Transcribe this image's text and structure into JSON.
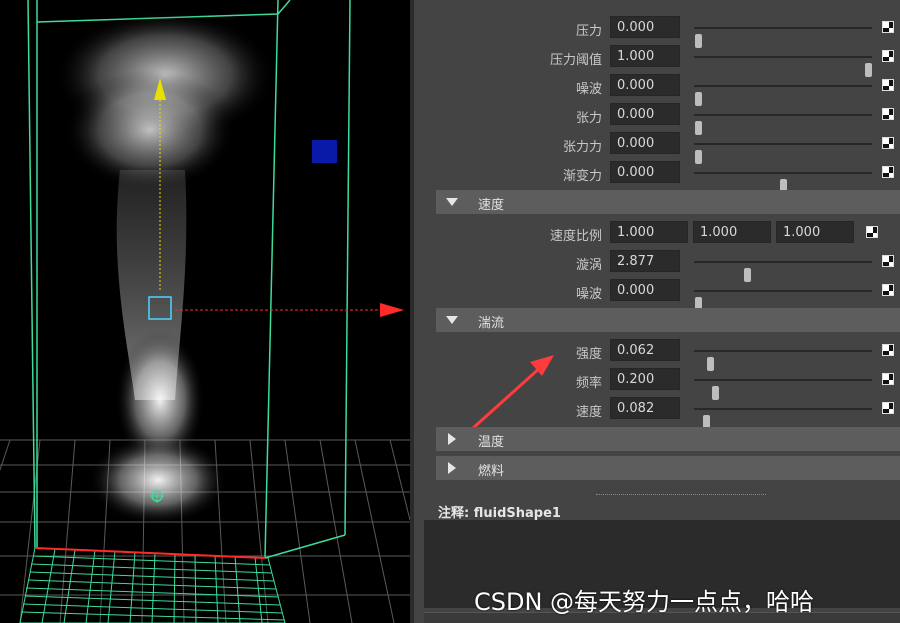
{
  "panel": {
    "top_rows": [
      {
        "label": "压力",
        "value": "0.000",
        "slider_fraction": 0.0
      },
      {
        "label": "压力阈值",
        "value": "1.000",
        "slider_fraction": 1.0
      },
      {
        "label": "噪波",
        "value": "0.000",
        "slider_fraction": 0.0
      },
      {
        "label": "张力",
        "value": "0.000",
        "slider_fraction": 0.0
      },
      {
        "label": "张力力",
        "value": "0.000",
        "slider_fraction": 0.0
      },
      {
        "label": "渐变力",
        "value": "0.000",
        "slider_fraction": 0.5
      }
    ],
    "velocity": {
      "title": "速度",
      "scale_label": "速度比例",
      "scale_values": [
        "1.000",
        "1.000",
        "1.000"
      ],
      "rows": [
        {
          "label": "漩涡",
          "value": "2.877",
          "slider_fraction": 0.3
        },
        {
          "label": "噪波",
          "value": "0.000",
          "slider_fraction": 0.0
        }
      ]
    },
    "turbulence": {
      "title": "湍流",
      "rows": [
        {
          "label": "强度",
          "value": "0.062",
          "slider_fraction": 0.062
        },
        {
          "label": "频率",
          "value": "0.200",
          "slider_fraction": 0.1
        },
        {
          "label": "速度",
          "value": "0.082",
          "slider_fraction": 0.04
        }
      ]
    },
    "temperature": {
      "title": "温度"
    },
    "fuel": {
      "title": "燃料"
    },
    "notes_prefix": "注释:",
    "notes_node": "fluidShape1"
  },
  "watermark": "CSDN @每天努力一点点，哈哈",
  "colors": {
    "viewport_bg": "#000000",
    "wire": "#3ddc9a",
    "arrow_red": "#ff2a2a",
    "pivot_cyan": "#4fd3ff",
    "manip_yellow": "#e8e000",
    "blue_box": "#0a1aa8"
  }
}
